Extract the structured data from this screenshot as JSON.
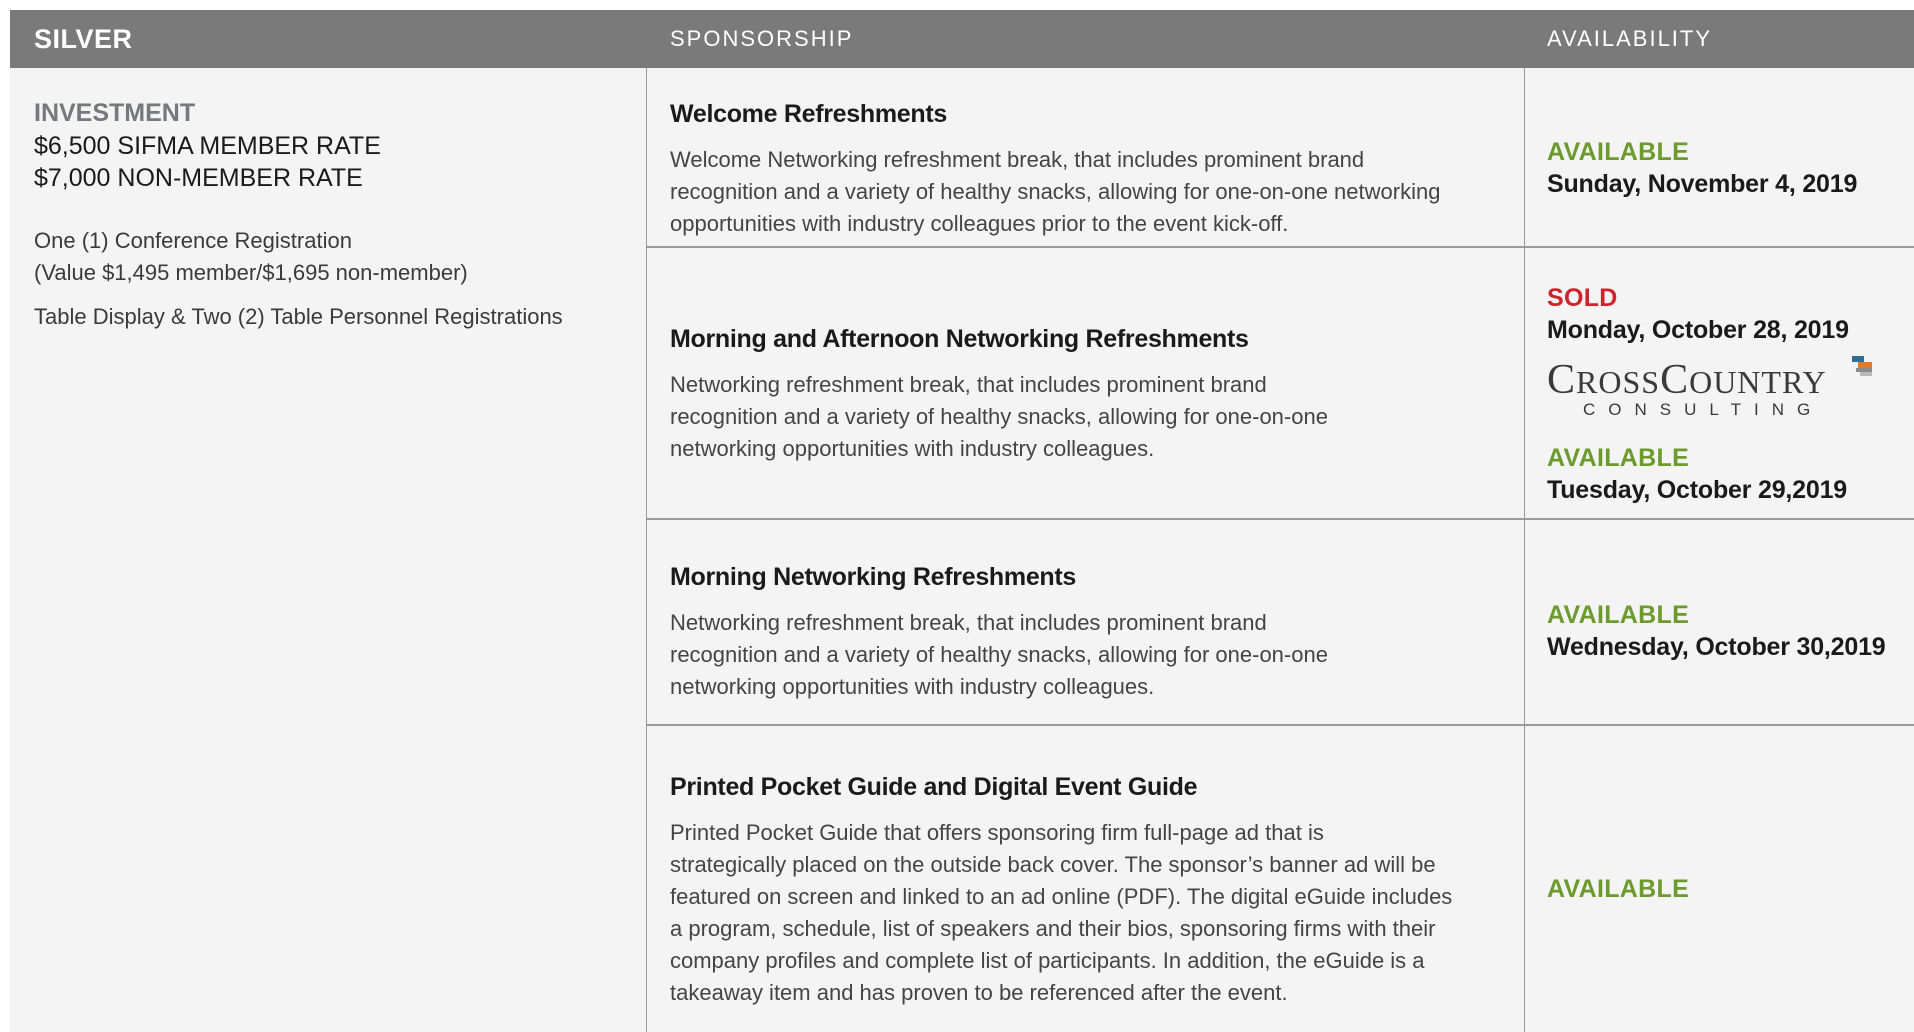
{
  "header": {
    "tier": "SILVER",
    "sponsorship": "SPONSORSHIP",
    "availability": "AVAILABILITY"
  },
  "investment": {
    "label": "INVESTMENT",
    "member_rate": "$6,500 SIFMA MEMBER RATE",
    "non_member_rate": "$7,000 NON-MEMBER RATE",
    "registration_line1": "One (1) Conference Registration",
    "registration_line2": "(Value $1,495 member/$1,695 non-member)",
    "table_display": "Table Display & Two (2) Table Personnel Registrations"
  },
  "rows": [
    {
      "title": "Welcome Refreshments",
      "desc": [
        "Welcome Networking refreshment break, that includes prominent brand",
        "recognition and a variety of healthy snacks, allowing for one-on-one networking",
        "opportunities with industry colleagues prior to the event kick-off."
      ],
      "status": "AVAILABLE",
      "date": "Sunday, November 4, 2019"
    },
    {
      "title": "Morning and Afternoon Networking Refreshments",
      "desc": [
        "Networking refreshment break, that includes prominent brand",
        "recognition and a variety of healthy snacks, allowing for one-on-one",
        "networking opportunities with industry colleagues."
      ],
      "status": "SOLD",
      "date": "Monday, October 28, 2019",
      "sponsor_logo": {
        "name_c": "C",
        "name_ross": "ROSS",
        "name_c2": "C",
        "name_ountry": "OUNTRY",
        "subtitle": "CONSULTING"
      },
      "status2": "AVAILABLE",
      "date2": "Tuesday, October 29,2019"
    },
    {
      "title": "Morning Networking Refreshments",
      "desc": [
        "Networking refreshment break, that includes prominent brand",
        "recognition and a variety of healthy snacks, allowing for one-on-one",
        "networking opportunities with industry colleagues."
      ],
      "status": "AVAILABLE",
      "date": "Wednesday, October 30,2019"
    },
    {
      "title": "Printed Pocket Guide and Digital Event Guide",
      "desc": [
        "Printed Pocket Guide that offers sponsoring firm full-page ad that is",
        "strategically placed on the outside back cover. The sponsor’s banner ad will be",
        "featured on screen and linked to an ad online (PDF). The digital eGuide includes",
        "a program, schedule, list of speakers and their bios, sponsoring firms with their",
        "company profiles and complete list of participants. In addition, the eGuide is a",
        "takeaway item and has proven to be referenced after the event."
      ],
      "status": "AVAILABLE"
    }
  ],
  "colors": {
    "header_bg": "#7a7a7b",
    "available": "#6c9a2c",
    "sold": "#d0232a",
    "cell_bg": "#f4f4f5"
  }
}
